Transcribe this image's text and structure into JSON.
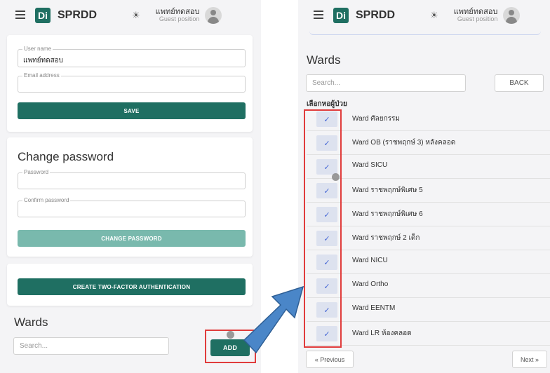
{
  "header": {
    "app_title": "SPRDD",
    "logo_text": "Di",
    "user_name": "แพทย์ทดสอบ",
    "user_role": "Guest position"
  },
  "profile": {
    "username_label": "User name",
    "username_value": "แพทย์ทดสอบ",
    "email_label": "Email address",
    "save_label": "SAVE"
  },
  "change_password": {
    "title": "Change password",
    "password_label": "Password",
    "confirm_label": "Confirm password",
    "button_label": "CHANGE PASSWORD"
  },
  "two_factor": {
    "button_label": "CREATE TWO-FACTOR AUTHENTICATION"
  },
  "wards_left": {
    "title": "Wards",
    "search_placeholder": "Search...",
    "add_label": "ADD"
  },
  "wards_dialog": {
    "title": "Wards",
    "search_placeholder": "Search...",
    "back_label": "BACK",
    "list_heading": "เลือกหอผู้ป่วย",
    "items": [
      {
        "label": "Ward ศัลยกรรม",
        "checked": true
      },
      {
        "label": "Ward OB (ราชพฤกษ์ 3) หลังคลอด",
        "checked": true
      },
      {
        "label": "Ward SICU",
        "checked": true
      },
      {
        "label": "Ward ราชพฤกษ์พิเศษ 5",
        "checked": true
      },
      {
        "label": "Ward ราชพฤกษ์พิเศษ 6",
        "checked": true
      },
      {
        "label": "Ward ราชพฤกษ์ 2 เด็ก",
        "checked": true
      },
      {
        "label": "Ward NICU",
        "checked": true
      },
      {
        "label": "Ward Ortho",
        "checked": true
      },
      {
        "label": "Ward EENTM",
        "checked": true
      },
      {
        "label": "Ward LR ห้องคลอด",
        "checked": true
      }
    ],
    "prev_label": "« Previous",
    "next_label": "Next »"
  },
  "colors": {
    "primary": "#1f6f62",
    "primary_light": "#79b9ad",
    "highlight_red": "#e03c3c",
    "arrow_blue": "#4a86c8",
    "check_bg": "#dde2ef"
  }
}
